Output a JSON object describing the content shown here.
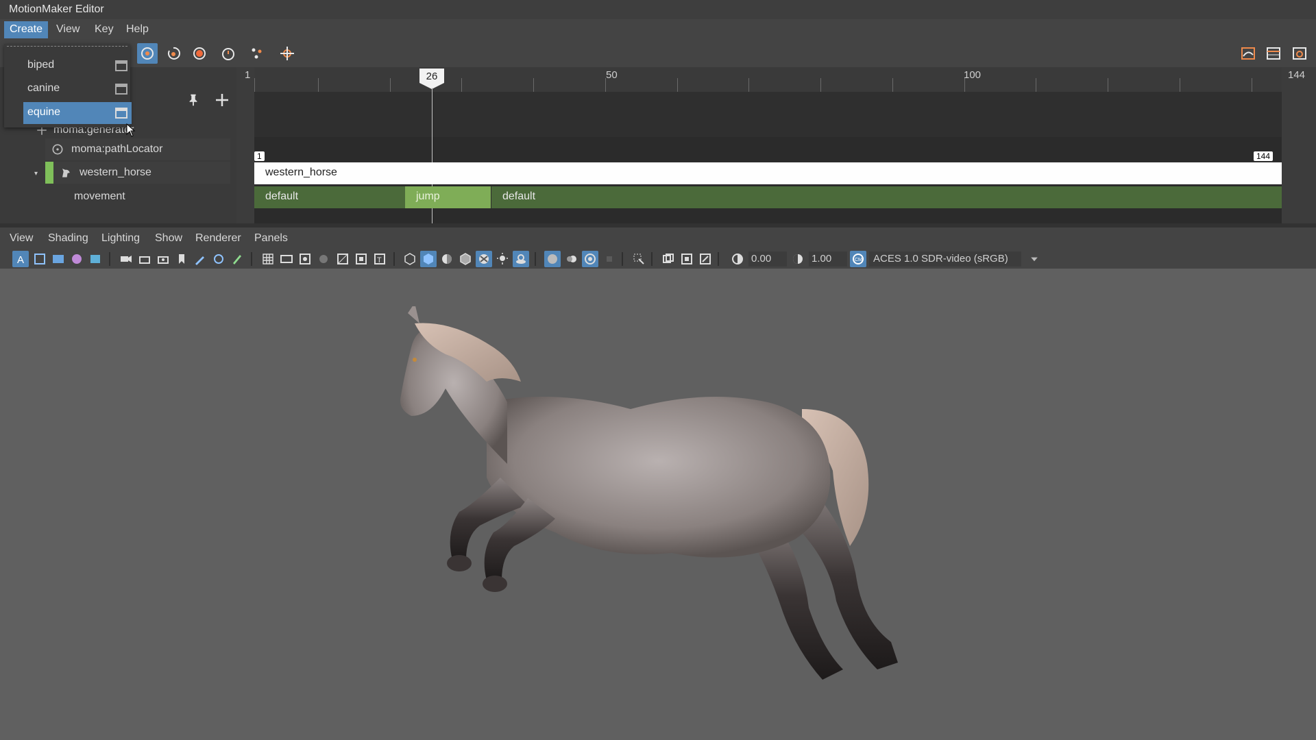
{
  "app": {
    "title": "MotionMaker Editor"
  },
  "menubar": {
    "items": [
      "Create",
      "View",
      "Key",
      "Help"
    ]
  },
  "dropdown": {
    "items": [
      "biped",
      "canine",
      "equine"
    ]
  },
  "outliner": {
    "generator": "moma:generator",
    "path_locator": "moma:pathLocator",
    "character": "western_horse",
    "channel": "movement",
    "character_color": "#7fbf5a"
  },
  "timeline": {
    "start": "1",
    "end": "144",
    "current_frame": "26",
    "ticks": [
      "1",
      "50",
      "100",
      "144"
    ],
    "range_start": "1",
    "range_end": "144",
    "clip_track": "western_horse",
    "movement_clips": [
      "default",
      "jump",
      "default"
    ]
  },
  "viewport": {
    "menus": [
      "View",
      "Shading",
      "Lighting",
      "Show",
      "Renderer",
      "Panels"
    ],
    "exposure": "0.00",
    "gamma": "1.00",
    "color_space": "ACES 1.0 SDR-video (sRGB)"
  },
  "colors": {
    "accent": "#5186b8",
    "jump_clip": "#7fad57",
    "default_clip": "#4b6a3a"
  }
}
